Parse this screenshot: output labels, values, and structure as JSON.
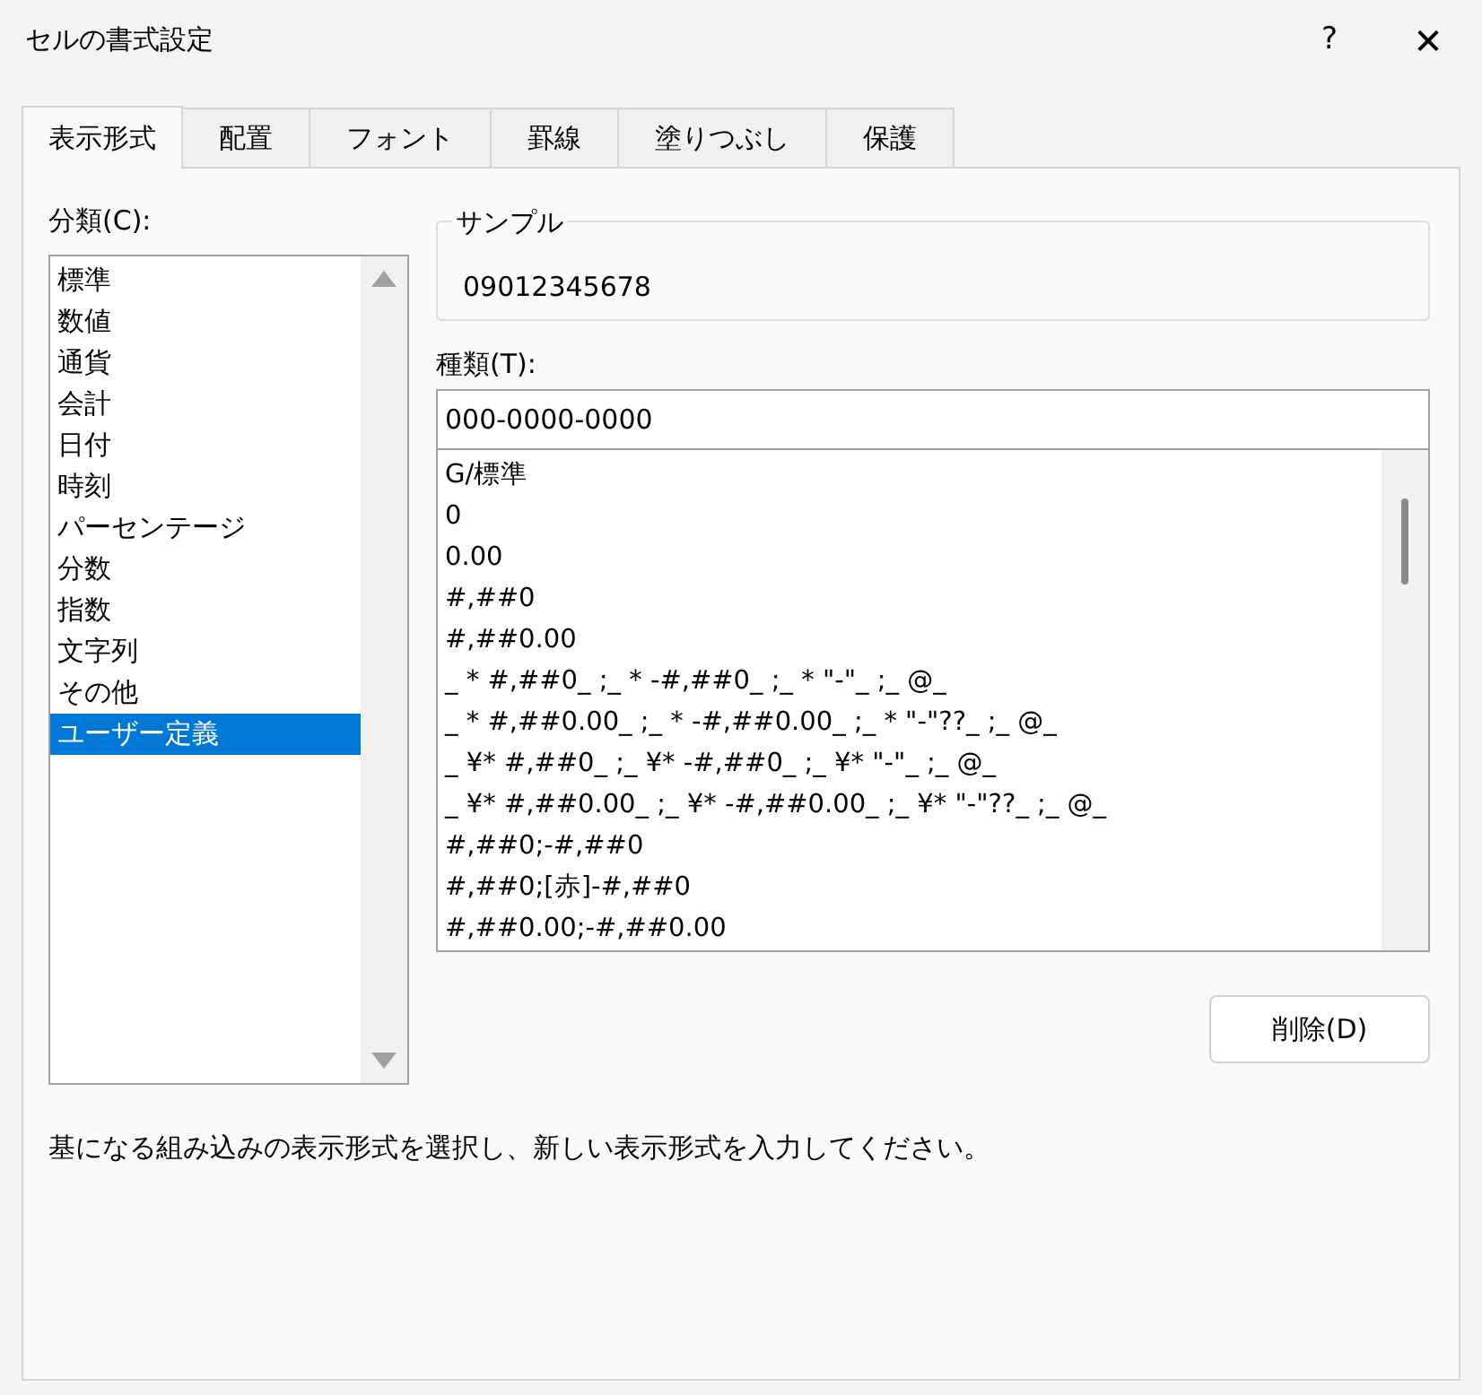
{
  "window": {
    "title": "セルの書式設定",
    "help": "?",
    "close": "✕"
  },
  "tabs": [
    {
      "label": "表示形式",
      "selected": true
    },
    {
      "label": "配置",
      "selected": false
    },
    {
      "label": "フォント",
      "selected": false
    },
    {
      "label": "罫線",
      "selected": false
    },
    {
      "label": "塗りつぶし",
      "selected": false
    },
    {
      "label": "保護",
      "selected": false
    }
  ],
  "category": {
    "label": "分類(C):",
    "items": [
      {
        "label": "標準",
        "selected": false
      },
      {
        "label": "数値",
        "selected": false
      },
      {
        "label": "通貨",
        "selected": false
      },
      {
        "label": "会計",
        "selected": false
      },
      {
        "label": "日付",
        "selected": false
      },
      {
        "label": "時刻",
        "selected": false
      },
      {
        "label": "パーセンテージ",
        "selected": false
      },
      {
        "label": "分数",
        "selected": false
      },
      {
        "label": "指数",
        "selected": false
      },
      {
        "label": "文字列",
        "selected": false
      },
      {
        "label": "その他",
        "selected": false
      },
      {
        "label": "ユーザー定義",
        "selected": true
      }
    ]
  },
  "sample": {
    "label": "サンプル",
    "value": "09012345678"
  },
  "type": {
    "label": "種類(T):",
    "value": "000-0000-0000",
    "formats": [
      "G/標準",
      "0",
      "0.00",
      "#,##0",
      "#,##0.00",
      "_ * #,##0_ ;_ * -#,##0_ ;_ * \"-\"_ ;_ @_",
      "_ * #,##0.00_ ;_ * -#,##0.00_ ;_ * \"-\"??_ ;_ @_",
      "_ ¥* #,##0_ ;_ ¥* -#,##0_ ;_ ¥* \"-\"_ ;_ @_",
      "_ ¥* #,##0.00_ ;_ ¥* -#,##0.00_ ;_ ¥* \"-\"??_ ;_ @_",
      "#,##0;-#,##0",
      "#,##0;[赤]-#,##0",
      "#,##0.00;-#,##0.00"
    ]
  },
  "delete_button": "削除(D)",
  "description": "基になる組み込みの表示形式を選択し、新しい表示形式を入力してください。"
}
